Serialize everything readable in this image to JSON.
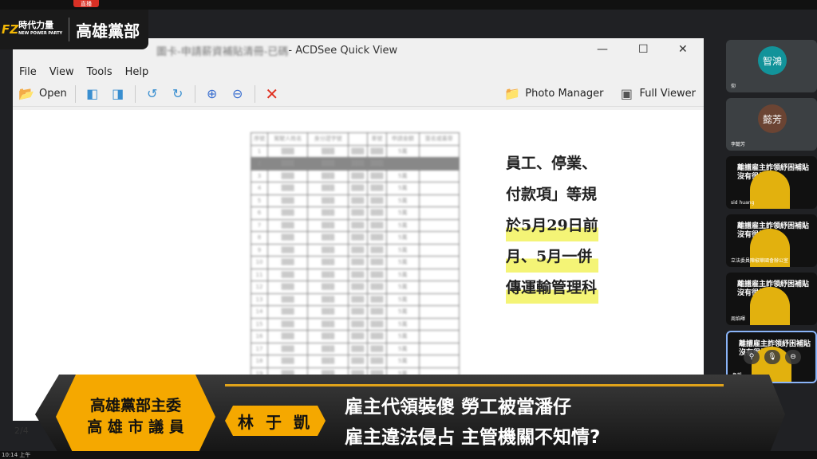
{
  "overlay": {
    "logo_mark": "FZ",
    "logo_cn": "時代力量",
    "logo_en": "NEW POWER PARTY",
    "party_unit": "高雄黨部",
    "live_badge": "直播"
  },
  "window": {
    "title_prefix": "圖卡-申請薪資補貼清冊-已碼",
    "title_app": " - ACDSee Quick View",
    "minimize": "—",
    "maximize": "☐",
    "close": "✕"
  },
  "menu": [
    "File",
    "View",
    "Tools",
    "Help"
  ],
  "toolbar": {
    "open": "Open",
    "photo_manager": "Photo Manager",
    "full_viewer": "Full Viewer"
  },
  "document": {
    "headers": [
      "序號",
      "駕駛人姓名",
      "身分證字號",
      "",
      "車號",
      "申請金額",
      "簽名或蓋章"
    ],
    "amount": "5萬",
    "rows": 20,
    "right_text": [
      "員工、停業、",
      "付款項」等規",
      "於5月29日前",
      "月、5月一併",
      "傳運輸管理科"
    ]
  },
  "status": {
    "page": "2/4",
    "clock": "10:14 上午"
  },
  "participants": [
    {
      "avatar": "智鴻",
      "color": "#12939a",
      "name": "仰"
    },
    {
      "avatar": "懿芳",
      "color": "#6b4433",
      "name": "李懿芳"
    },
    {
      "name": "sid huang"
    },
    {
      "name": "立法委員陳椒華國會辦公室"
    },
    {
      "name": "周焰暉"
    },
    {
      "name": "魯凱"
    }
  ],
  "video_overlay_text": [
    "離譜雇主詐領紓困補貼",
    "沒有很扯"
  ],
  "banner": {
    "role_line1": "高雄黨部主委",
    "role_line2": "高 雄 市 議 員",
    "name": "林 于 凱",
    "headline1": "雇主代領裝傻 勞工被當潘仔",
    "headline2": "雇主違法侵占 主管機關不知情?"
  },
  "colors": {
    "accent": "#f5a800",
    "banner_bg": "#222222"
  }
}
